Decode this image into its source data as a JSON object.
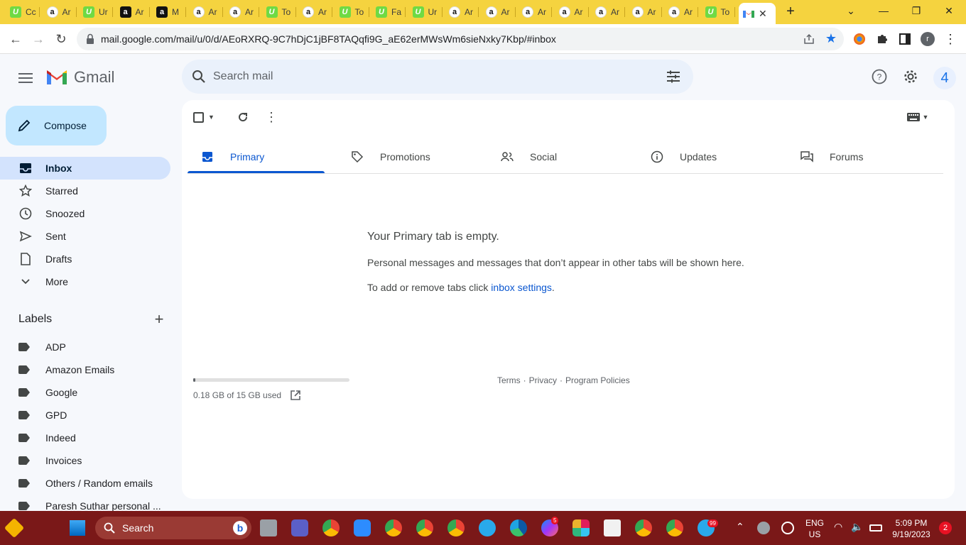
{
  "browser": {
    "tabs": [
      {
        "favicon": "upwork-icon",
        "title": "Cc"
      },
      {
        "favicon": "amazon-icon",
        "title": "Ar"
      },
      {
        "favicon": "upwork-icon",
        "title": "Ur"
      },
      {
        "favicon": "amazon-dark-icon",
        "title": "Ar"
      },
      {
        "favicon": "amazon-dark-icon",
        "title": "M"
      },
      {
        "favicon": "amazon-icon",
        "title": "Ar"
      },
      {
        "favicon": "amazon-icon",
        "title": "Ar"
      },
      {
        "favicon": "upwork-icon",
        "title": "To"
      },
      {
        "favicon": "amazon-icon",
        "title": "Ar"
      },
      {
        "favicon": "upwork-icon",
        "title": "To"
      },
      {
        "favicon": "upwork-icon",
        "title": "Fa"
      },
      {
        "favicon": "upwork-icon",
        "title": "Ur"
      },
      {
        "favicon": "amazon-icon",
        "title": "Ar"
      },
      {
        "favicon": "amazon-icon",
        "title": "Ar"
      },
      {
        "favicon": "amazon-icon",
        "title": "Ar"
      },
      {
        "favicon": "amazon-icon",
        "title": "Ar"
      },
      {
        "favicon": "amazon-icon",
        "title": "Ar"
      },
      {
        "favicon": "amazon-icon",
        "title": "Ar"
      },
      {
        "favicon": "amazon-icon",
        "title": "Ar"
      },
      {
        "favicon": "upwork-icon",
        "title": "To"
      }
    ],
    "active_tab_favicon": "gmail-icon",
    "url": "mail.google.com/mail/u/0/d/AEoRXRQ-9C7hDjC1jBF8TAQqfi9G_aE62erMWsWm6sieNxky7Kbp/#inbox",
    "profile_initial": "r",
    "tab_bar_color": "#f5d33f"
  },
  "gmail": {
    "logo_text": "Gmail",
    "search_placeholder": "Search mail",
    "account_initial": "4",
    "compose_label": "Compose",
    "nav": [
      {
        "key": "inbox",
        "label": "Inbox",
        "icon": "inbox-icon",
        "active": true
      },
      {
        "key": "starred",
        "label": "Starred",
        "icon": "star-icon"
      },
      {
        "key": "snoozed",
        "label": "Snoozed",
        "icon": "clock-icon"
      },
      {
        "key": "sent",
        "label": "Sent",
        "icon": "send-icon"
      },
      {
        "key": "drafts",
        "label": "Drafts",
        "icon": "draft-icon"
      },
      {
        "key": "more",
        "label": "More",
        "icon": "chevron-down-icon"
      }
    ],
    "labels_heading": "Labels",
    "labels": [
      "ADP",
      "Amazon Emails",
      "Google",
      "GPD",
      "Indeed",
      "Invoices",
      "Others / Random emails",
      "Paresh Suthar personal ..."
    ],
    "categories": [
      {
        "label": "Primary",
        "icon": "inbox-tab-icon",
        "active": true
      },
      {
        "label": "Promotions",
        "icon": "tag-icon"
      },
      {
        "label": "Social",
        "icon": "people-icon"
      },
      {
        "label": "Updates",
        "icon": "info-icon"
      },
      {
        "label": "Forums",
        "icon": "forum-icon"
      }
    ],
    "empty": {
      "title": "Your Primary tab is empty.",
      "subtitle": "Personal messages and messages that don’t appear in other tabs will be shown here.",
      "settings_prefix": "To add or remove tabs click ",
      "settings_link": "inbox settings",
      "settings_suffix": "."
    },
    "storage": {
      "text": "0.18 GB of 15 GB used",
      "used_fraction": 0.012
    },
    "footer": {
      "terms": "Terms",
      "privacy": "Privacy",
      "policies": "Program Policies",
      "sep": "·"
    },
    "accent": "#0b57d0"
  },
  "taskbar": {
    "search_label": "Search",
    "lang_top": "ENG",
    "lang_bottom": "US",
    "time": "5:09 PM",
    "date": "9/19/2023",
    "notification_count": "2",
    "messenger_badge": "5",
    "telegram_badge": "99",
    "color": "#7a1818"
  }
}
